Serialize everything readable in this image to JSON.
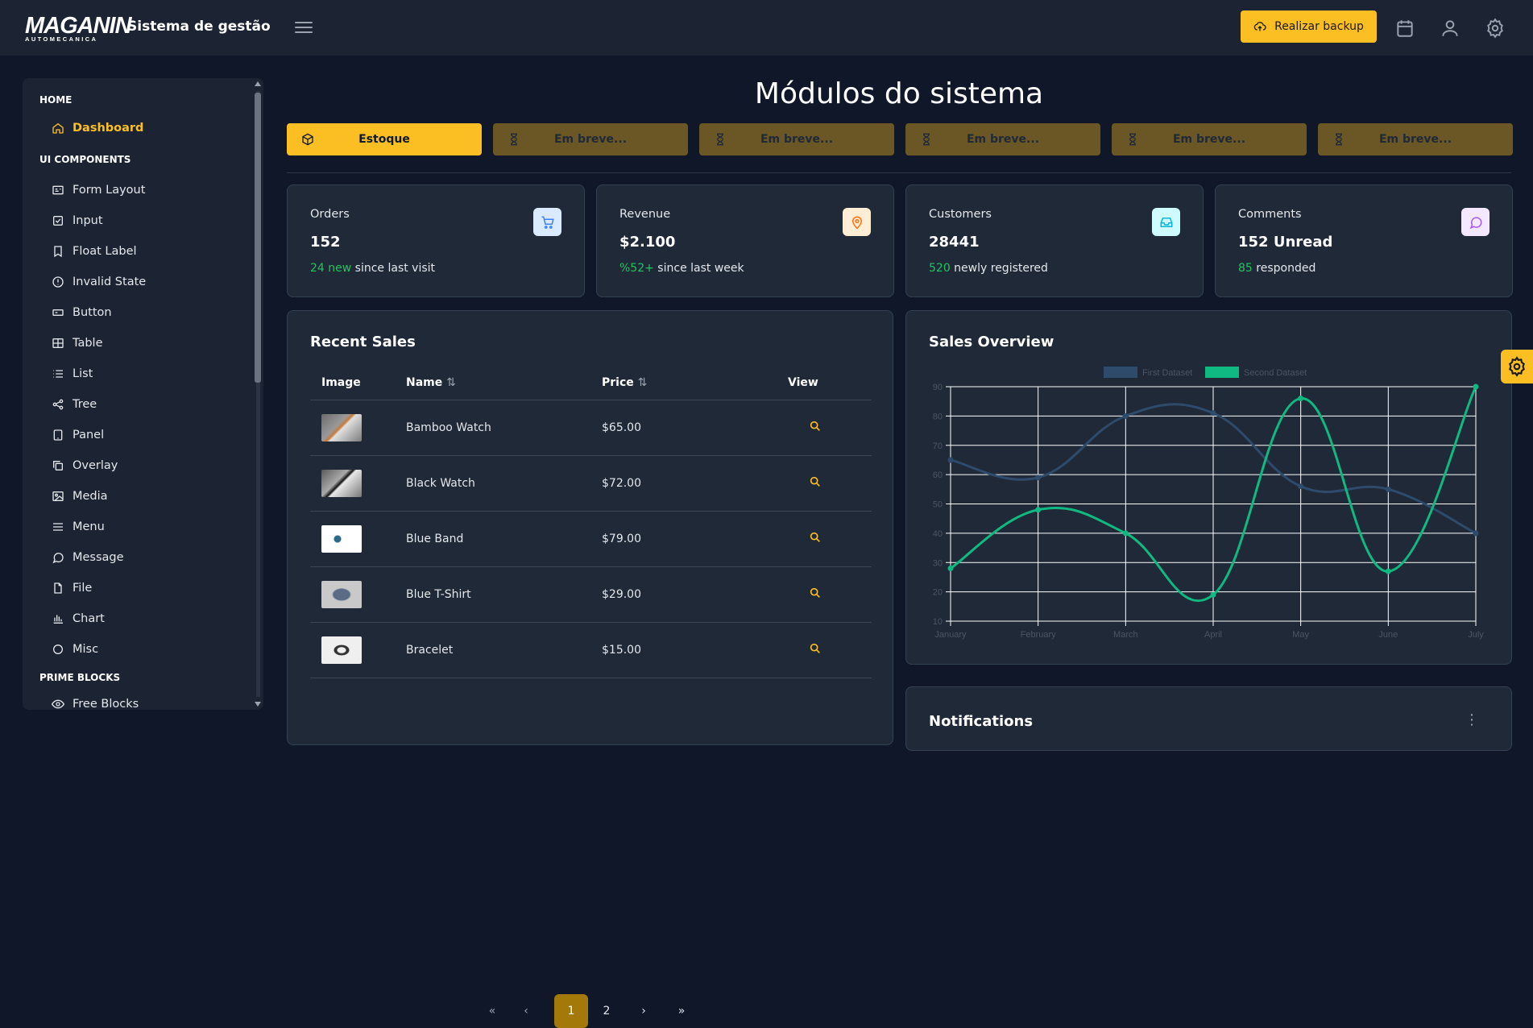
{
  "header": {
    "logo_brand": "MAGANIN",
    "logo_sub": "AUTOMECANICA",
    "app_title": "Sistema de gestão",
    "backup_label": "Realizar backup"
  },
  "sidebar": {
    "sections": [
      {
        "title": "HOME"
      },
      {
        "title": "UI COMPONENTS"
      },
      {
        "title": "PRIME BLOCKS"
      }
    ],
    "home_items": [
      {
        "label": "Dashboard",
        "icon": "home-icon"
      }
    ],
    "ui_items": [
      {
        "label": "Form Layout",
        "icon": "id-card-icon"
      },
      {
        "label": "Input",
        "icon": "check-square-icon"
      },
      {
        "label": "Float Label",
        "icon": "bookmark-icon"
      },
      {
        "label": "Invalid State",
        "icon": "exclamation-circle-icon"
      },
      {
        "label": "Button",
        "icon": "button-icon"
      },
      {
        "label": "Table",
        "icon": "table-icon"
      },
      {
        "label": "List",
        "icon": "list-icon"
      },
      {
        "label": "Tree",
        "icon": "share-icon"
      },
      {
        "label": "Panel",
        "icon": "tablet-icon"
      },
      {
        "label": "Overlay",
        "icon": "clone-icon"
      },
      {
        "label": "Media",
        "icon": "image-icon"
      },
      {
        "label": "Menu",
        "icon": "bars-icon"
      },
      {
        "label": "Message",
        "icon": "comment-icon"
      },
      {
        "label": "File",
        "icon": "file-icon"
      },
      {
        "label": "Chart",
        "icon": "chart-bar-icon"
      },
      {
        "label": "Misc",
        "icon": "circle-icon"
      }
    ],
    "blocks_items": [
      {
        "label": "Free Blocks",
        "icon": "eye-icon"
      }
    ]
  },
  "main": {
    "title": "Módulos do sistema",
    "modules": [
      {
        "label": "Estoque",
        "active": true
      },
      {
        "label": "Em breve...",
        "active": false
      },
      {
        "label": "Em breve...",
        "active": false
      },
      {
        "label": "Em breve...",
        "active": false
      },
      {
        "label": "Em breve...",
        "active": false
      },
      {
        "label": "Em breve...",
        "active": false
      }
    ]
  },
  "stats": [
    {
      "label": "Orders",
      "value": "152",
      "highlight": "24 new",
      "note": " since last visit",
      "icon": "shopping-cart-icon",
      "icon_bg": "#dbeafe",
      "icon_color": "#3b82f6"
    },
    {
      "label": "Revenue",
      "value": "$2.100",
      "highlight": "%52+",
      "note": " since last week",
      "icon": "map-marker-icon",
      "icon_bg": "#ffedd5",
      "icon_color": "#f97316"
    },
    {
      "label": "Customers",
      "value": "28441",
      "highlight": "520",
      "note": " newly registered",
      "icon": "inbox-icon",
      "icon_bg": "#cffafe",
      "icon_color": "#06b6d4"
    },
    {
      "label": "Comments",
      "value": "152 Unread",
      "highlight": "85",
      "note": " responded",
      "icon": "comment-icon",
      "icon_bg": "#f3e8ff",
      "icon_color": "#a855f7"
    }
  ],
  "recent_sales": {
    "title": "Recent Sales",
    "columns": [
      "Image",
      "Name",
      "Price",
      "View"
    ],
    "rows": [
      {
        "name": "Bamboo Watch",
        "price": "$65.00"
      },
      {
        "name": "Black Watch",
        "price": "$72.00"
      },
      {
        "name": "Blue Band",
        "price": "$79.00"
      },
      {
        "name": "Blue T-Shirt",
        "price": "$29.00"
      },
      {
        "name": "Bracelet",
        "price": "$15.00"
      }
    ],
    "pagination": {
      "pages": [
        "1",
        "2"
      ],
      "current": "1"
    }
  },
  "sales_overview": {
    "title": "Sales Overview"
  },
  "notifications": {
    "title": "Notifications"
  },
  "colors": {
    "accent": "#fbbf24",
    "bg": "#0f1729",
    "surface": "#1f2937",
    "success": "#22c55e"
  },
  "chart_data": {
    "type": "line",
    "x": [
      "January",
      "February",
      "March",
      "April",
      "May",
      "June",
      "July"
    ],
    "series": [
      {
        "name": "First Dataset",
        "values": [
          65,
          59,
          80,
          81,
          56,
          55,
          40
        ],
        "color": "#2f4b6b"
      },
      {
        "name": "Second Dataset",
        "values": [
          28,
          48,
          40,
          19,
          86,
          27,
          90
        ],
        "color": "#10b981"
      }
    ],
    "yticks": [
      10,
      20,
      30,
      40,
      50,
      60,
      70,
      80,
      90
    ],
    "ylim": [
      10,
      90
    ],
    "grid": true,
    "legend": "top"
  }
}
